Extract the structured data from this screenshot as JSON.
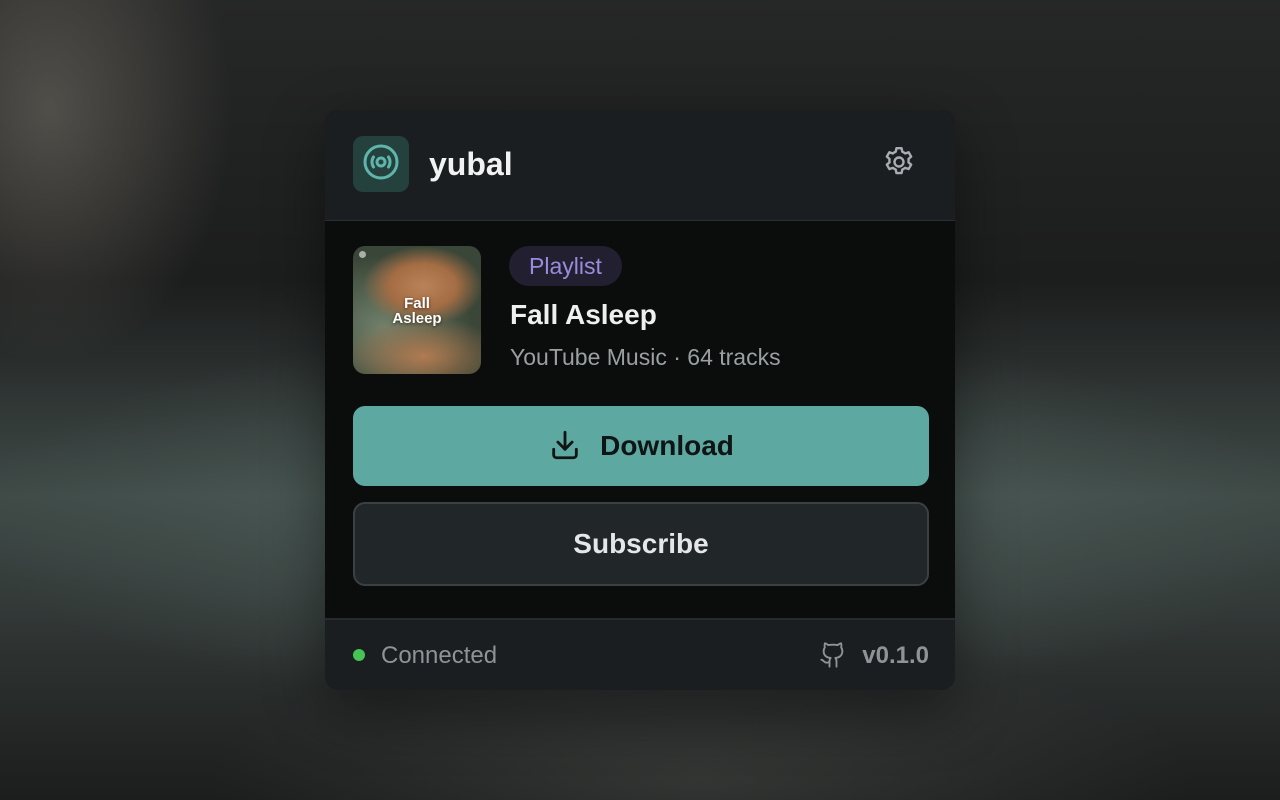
{
  "app": {
    "title": "yubal",
    "logo_icon": "disc-icon",
    "settings_icon": "gear-icon"
  },
  "item": {
    "type_badge": "Playlist",
    "title": "Fall Asleep",
    "meta": "YouTube Music · 64 tracks",
    "thumbnail_text_line1": "Fall",
    "thumbnail_text_line2": "Asleep"
  },
  "actions": {
    "download_label": "Download",
    "download_icon": "download-icon",
    "subscribe_label": "Subscribe"
  },
  "footer": {
    "status": "Connected",
    "status_color": "#45c455",
    "github_icon": "github-icon",
    "version": "v0.1.0"
  },
  "colors": {
    "accent": "#5da8a0",
    "badge_text": "#9a8cdc",
    "card_bg": "#0b0c0c",
    "header_bg": "#1b1e20"
  }
}
